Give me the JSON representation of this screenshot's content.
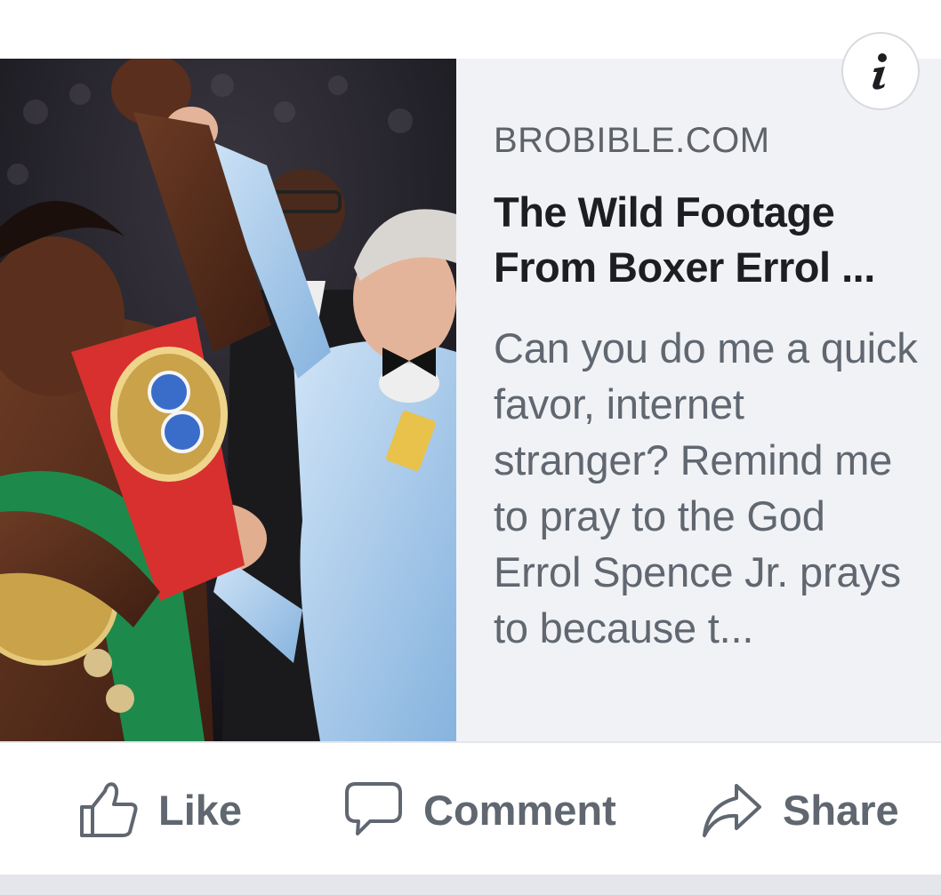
{
  "link_preview": {
    "domain": "BROBIBLE.COM",
    "headline": "The Wild Footage From Boxer Errol ...",
    "description": "Can you do me a quick favor, internet stranger? Remind me to pray to the God Errol Spence Jr. prays to because t...",
    "info_icon": "info-icon"
  },
  "actions": {
    "like_label": "Like",
    "comment_label": "Comment",
    "share_label": "Share"
  },
  "colors": {
    "preview_background": "#f0f2f5",
    "headline_text": "#1c1e21",
    "secondary_text": "#606770",
    "divider": "#e4e6eb"
  }
}
